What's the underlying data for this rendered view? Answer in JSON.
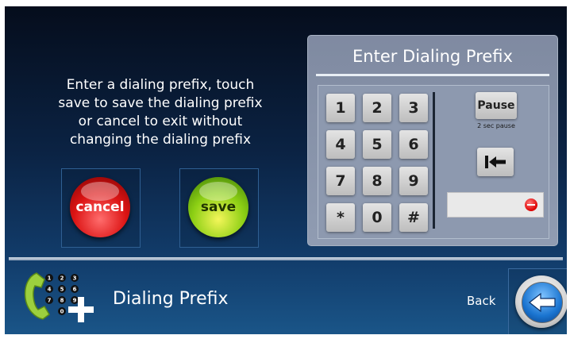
{
  "instructions": {
    "line1": "Enter a dialing prefix, touch",
    "line2": "save to save the dialing prefix",
    "line3": "or cancel to exit without",
    "line4": "changing the dialing prefix"
  },
  "actions": {
    "cancel_label": "cancel",
    "save_label": "save"
  },
  "keypad": {
    "title": "Enter Dialing Prefix",
    "keys": [
      "1",
      "2",
      "3",
      "4",
      "5",
      "6",
      "7",
      "8",
      "9",
      "*",
      "0",
      "#"
    ],
    "pause_label": "Pause",
    "pause_caption": "2 sec pause",
    "entry_value": ""
  },
  "footer": {
    "title": "Dialing Prefix",
    "back_label": "Back",
    "icon_digits": [
      "1",
      "2",
      "3",
      "4",
      "5",
      "6",
      "7",
      "8",
      "9",
      "0"
    ]
  },
  "colors": {
    "cancel": "#dc1414",
    "save": "#8ccf14",
    "back_arrow": "#1a74d0",
    "background": "#0b2344"
  },
  "icons": [
    "dialpad-handset-icon",
    "backspace-icon",
    "clear-icon",
    "back-arrow-icon"
  ]
}
